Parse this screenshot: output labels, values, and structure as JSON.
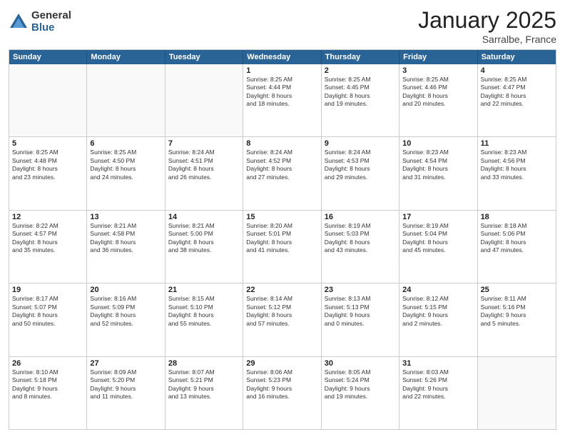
{
  "logo": {
    "general": "General",
    "blue": "Blue"
  },
  "title": "January 2025",
  "location": "Sarralbe, France",
  "weekdays": [
    "Sunday",
    "Monday",
    "Tuesday",
    "Wednesday",
    "Thursday",
    "Friday",
    "Saturday"
  ],
  "weeks": [
    [
      {
        "day": "",
        "info": ""
      },
      {
        "day": "",
        "info": ""
      },
      {
        "day": "",
        "info": ""
      },
      {
        "day": "1",
        "info": "Sunrise: 8:25 AM\nSunset: 4:44 PM\nDaylight: 8 hours\nand 18 minutes."
      },
      {
        "day": "2",
        "info": "Sunrise: 8:25 AM\nSunset: 4:45 PM\nDaylight: 8 hours\nand 19 minutes."
      },
      {
        "day": "3",
        "info": "Sunrise: 8:25 AM\nSunset: 4:46 PM\nDaylight: 8 hours\nand 20 minutes."
      },
      {
        "day": "4",
        "info": "Sunrise: 8:25 AM\nSunset: 4:47 PM\nDaylight: 8 hours\nand 22 minutes."
      }
    ],
    [
      {
        "day": "5",
        "info": "Sunrise: 8:25 AM\nSunset: 4:48 PM\nDaylight: 8 hours\nand 23 minutes."
      },
      {
        "day": "6",
        "info": "Sunrise: 8:25 AM\nSunset: 4:50 PM\nDaylight: 8 hours\nand 24 minutes."
      },
      {
        "day": "7",
        "info": "Sunrise: 8:24 AM\nSunset: 4:51 PM\nDaylight: 8 hours\nand 26 minutes."
      },
      {
        "day": "8",
        "info": "Sunrise: 8:24 AM\nSunset: 4:52 PM\nDaylight: 8 hours\nand 27 minutes."
      },
      {
        "day": "9",
        "info": "Sunrise: 8:24 AM\nSunset: 4:53 PM\nDaylight: 8 hours\nand 29 minutes."
      },
      {
        "day": "10",
        "info": "Sunrise: 8:23 AM\nSunset: 4:54 PM\nDaylight: 8 hours\nand 31 minutes."
      },
      {
        "day": "11",
        "info": "Sunrise: 8:23 AM\nSunset: 4:56 PM\nDaylight: 8 hours\nand 33 minutes."
      }
    ],
    [
      {
        "day": "12",
        "info": "Sunrise: 8:22 AM\nSunset: 4:57 PM\nDaylight: 8 hours\nand 35 minutes."
      },
      {
        "day": "13",
        "info": "Sunrise: 8:21 AM\nSunset: 4:58 PM\nDaylight: 8 hours\nand 36 minutes."
      },
      {
        "day": "14",
        "info": "Sunrise: 8:21 AM\nSunset: 5:00 PM\nDaylight: 8 hours\nand 38 minutes."
      },
      {
        "day": "15",
        "info": "Sunrise: 8:20 AM\nSunset: 5:01 PM\nDaylight: 8 hours\nand 41 minutes."
      },
      {
        "day": "16",
        "info": "Sunrise: 8:19 AM\nSunset: 5:03 PM\nDaylight: 8 hours\nand 43 minutes."
      },
      {
        "day": "17",
        "info": "Sunrise: 8:19 AM\nSunset: 5:04 PM\nDaylight: 8 hours\nand 45 minutes."
      },
      {
        "day": "18",
        "info": "Sunrise: 8:18 AM\nSunset: 5:06 PM\nDaylight: 8 hours\nand 47 minutes."
      }
    ],
    [
      {
        "day": "19",
        "info": "Sunrise: 8:17 AM\nSunset: 5:07 PM\nDaylight: 8 hours\nand 50 minutes."
      },
      {
        "day": "20",
        "info": "Sunrise: 8:16 AM\nSunset: 5:09 PM\nDaylight: 8 hours\nand 52 minutes."
      },
      {
        "day": "21",
        "info": "Sunrise: 8:15 AM\nSunset: 5:10 PM\nDaylight: 8 hours\nand 55 minutes."
      },
      {
        "day": "22",
        "info": "Sunrise: 8:14 AM\nSunset: 5:12 PM\nDaylight: 8 hours\nand 57 minutes."
      },
      {
        "day": "23",
        "info": "Sunrise: 8:13 AM\nSunset: 5:13 PM\nDaylight: 9 hours\nand 0 minutes."
      },
      {
        "day": "24",
        "info": "Sunrise: 8:12 AM\nSunset: 5:15 PM\nDaylight: 9 hours\nand 2 minutes."
      },
      {
        "day": "25",
        "info": "Sunrise: 8:11 AM\nSunset: 5:16 PM\nDaylight: 9 hours\nand 5 minutes."
      }
    ],
    [
      {
        "day": "26",
        "info": "Sunrise: 8:10 AM\nSunset: 5:18 PM\nDaylight: 9 hours\nand 8 minutes."
      },
      {
        "day": "27",
        "info": "Sunrise: 8:09 AM\nSunset: 5:20 PM\nDaylight: 9 hours\nand 11 minutes."
      },
      {
        "day": "28",
        "info": "Sunrise: 8:07 AM\nSunset: 5:21 PM\nDaylight: 9 hours\nand 13 minutes."
      },
      {
        "day": "29",
        "info": "Sunrise: 8:06 AM\nSunset: 5:23 PM\nDaylight: 9 hours\nand 16 minutes."
      },
      {
        "day": "30",
        "info": "Sunrise: 8:05 AM\nSunset: 5:24 PM\nDaylight: 9 hours\nand 19 minutes."
      },
      {
        "day": "31",
        "info": "Sunrise: 8:03 AM\nSunset: 5:26 PM\nDaylight: 9 hours\nand 22 minutes."
      },
      {
        "day": "",
        "info": ""
      }
    ]
  ]
}
